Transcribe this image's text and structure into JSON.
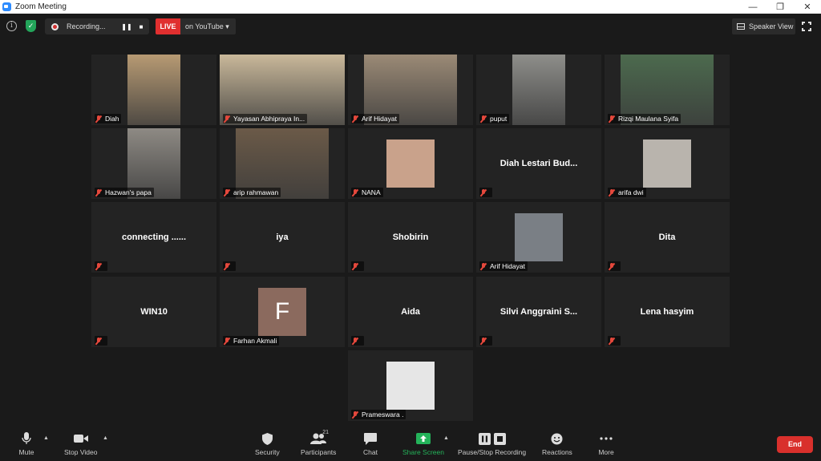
{
  "window": {
    "title": "Zoom Meeting",
    "controls": [
      "—",
      "❐",
      "✕"
    ]
  },
  "topbar": {
    "recording_label": "Recording...",
    "live_label": "LIVE",
    "live_destination": "on YouTube ▾",
    "speaker_view_label": "Speaker View"
  },
  "participants": [
    {
      "name": "Diah",
      "display": "video",
      "color": "#b79a73"
    },
    {
      "name": "Yayasan Abhipraya In...",
      "display": "video",
      "color": "#c9b89a",
      "active": true
    },
    {
      "name": "Arif Hidayat",
      "display": "video",
      "color": "#9b8a76"
    },
    {
      "name": "puput",
      "display": "video",
      "color": "#8e8e8a"
    },
    {
      "name": "Rizqi Maulana Syifa",
      "display": "video",
      "color": "#4c6a4e"
    },
    {
      "name": "Hazwan's papa",
      "display": "video",
      "color": "#8e8a84"
    },
    {
      "name": "arip rahmawan",
      "display": "video",
      "color": "#6b5a48"
    },
    {
      "name": "NANA",
      "display": "thumb",
      "color": "#c9a28b"
    },
    {
      "name": "Diah Lestari Bud...",
      "display": "name"
    },
    {
      "name": "arifa dwi",
      "display": "thumb",
      "color": "#b9b4ad"
    },
    {
      "name": "connecting ......",
      "display": "name"
    },
    {
      "name": "iya",
      "display": "name"
    },
    {
      "name": "Shobirin",
      "display": "name"
    },
    {
      "name": "Arif Hidayat",
      "display": "thumb",
      "color": "#7a7f85"
    },
    {
      "name": "Dita",
      "display": "name"
    },
    {
      "name": "WIN10",
      "display": "name"
    },
    {
      "name": "Farhan Akmali",
      "display": "avatar",
      "initial": "F"
    },
    {
      "name": "Aida",
      "display": "name"
    },
    {
      "name": "Silvi  Anggraini  S...",
      "display": "name"
    },
    {
      "name": "Lena hasyim",
      "display": "name"
    },
    {
      "name": "Prameswara .",
      "display": "thumb",
      "color": "#e6e6e6"
    }
  ],
  "controls": {
    "mute": "Mute",
    "stop_video": "Stop Video",
    "security": "Security",
    "participants": "Participants",
    "participant_count": "21",
    "chat": "Chat",
    "share_screen": "Share Screen",
    "pause_stop_recording": "Pause/Stop Recording",
    "reactions": "Reactions",
    "more": "More",
    "end": "End"
  }
}
